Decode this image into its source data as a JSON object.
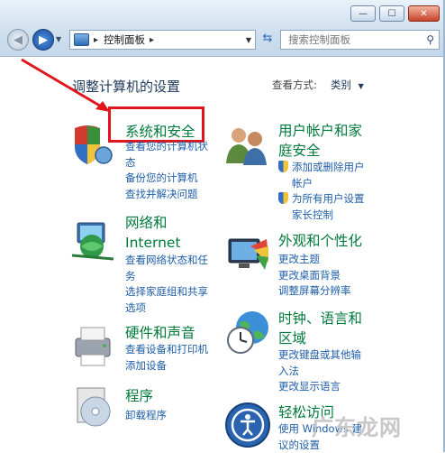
{
  "window": {
    "minimize_glyph": "—",
    "maximize_glyph": "☐",
    "close_glyph": "✕"
  },
  "nav": {
    "back_icon": "back-arrow-icon",
    "forward_icon": "forward-arrow-icon"
  },
  "address": {
    "separator": "▸",
    "location": "控制面板",
    "arrow": "▸"
  },
  "search": {
    "placeholder": "搜索控制面板"
  },
  "main": {
    "heading": "调整计算机的设置",
    "view_by_label": "查看方式:",
    "view_by_value": "类别"
  },
  "categories": [
    {
      "id": "system-security",
      "title_lines": [
        "系统和安全"
      ],
      "links": [
        "查看您的计算机状",
        "态",
        "备份您的计算机",
        "查找并解决问题"
      ]
    },
    {
      "id": "user-accounts",
      "title_lines": [
        "用户帐户和家",
        "庭安全"
      ],
      "links": [
        "添加或删除用户",
        "帐户",
        "为所有用户设置",
        "家长控制"
      ]
    },
    {
      "id": "network",
      "title_lines": [
        "网络和",
        "Internet"
      ],
      "links": [
        "查看网络状态和任",
        "务",
        "选择家庭组和共享",
        "选项"
      ]
    },
    {
      "id": "appearance",
      "title_lines": [
        "外观和个性化"
      ],
      "links": [
        "更改主题",
        "更改桌面背景",
        "调整屏幕分辨率"
      ]
    },
    {
      "id": "hardware-sound",
      "title_lines": [
        "硬件和声音"
      ],
      "links": [
        "查看设备和打印机",
        "添加设备"
      ]
    },
    {
      "id": "clock-region",
      "title_lines": [
        "时钟、语言和",
        "区域"
      ],
      "links": [
        "更改键盘或其他输",
        "入法",
        "更改显示语言"
      ]
    },
    {
      "id": "programs",
      "title_lines": [
        "程序"
      ],
      "links": [
        "卸载程序"
      ]
    },
    {
      "id": "ease-of-access",
      "title_lines": [
        "轻松访问"
      ],
      "links": [
        "使用 Windows 建",
        "议的设置"
      ]
    }
  ],
  "watermark": "广东龙网",
  "colors": {
    "category_title": "#007a3a",
    "link": "#1f5ea8",
    "annotation_red": "#e1161c"
  }
}
